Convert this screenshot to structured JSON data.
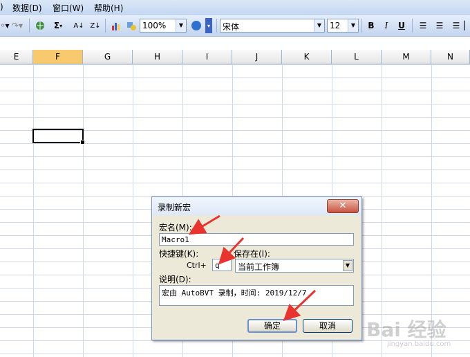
{
  "menu": {
    "items": [
      {
        "label": "数据(D)"
      },
      {
        "label": "窗口(W)"
      },
      {
        "label": "帮助(H)"
      }
    ]
  },
  "toolbar": {
    "zoom_value": "100%",
    "font_name": "宋体",
    "font_size": "12",
    "sigma": "Σ",
    "bold": "B",
    "italic": "I",
    "underline": "U",
    "sort_asc": "A↓",
    "sort_desc": "Z↓",
    "help": "?"
  },
  "columns": [
    "E",
    "F",
    "G",
    "H",
    "I",
    "J",
    "K",
    "L",
    "M",
    "N"
  ],
  "selected_column": "F",
  "dialog": {
    "title": "录制新宏",
    "close": "✕",
    "macro_name_label": "宏名(M):",
    "macro_name_value": "Macro1",
    "shortcut_label": "快捷键(K):",
    "ctrl_label": "Ctrl+",
    "shortcut_value": "q",
    "store_in_label": "保存在(I):",
    "store_in_value": "当前工作簿",
    "description_label": "说明(D):",
    "description_value": "宏由 AutoBVT 录制，时间: 2019/12/7",
    "ok_label": "确定",
    "cancel_label": "取消"
  },
  "watermark": {
    "text": "Bai 经验",
    "sub": "jingyan.baidu.com"
  },
  "colors": {
    "arrow": "#e8332f",
    "selected_header": "#f8c96d"
  }
}
